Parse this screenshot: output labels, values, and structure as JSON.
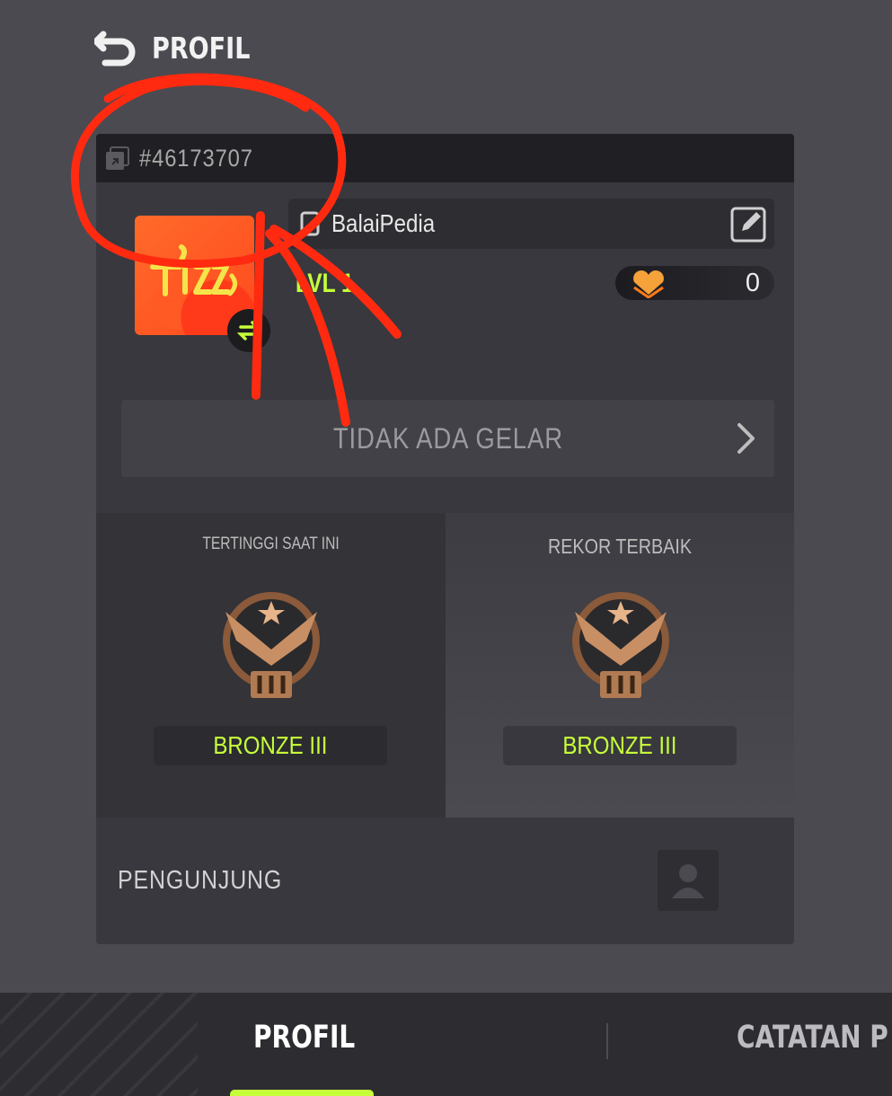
{
  "header": {
    "title": "PROFIL",
    "back_icon": "back-arrow-icon"
  },
  "profile": {
    "id_text": "#46173707",
    "nickname": "BalaiPedia",
    "level": "LVL 1",
    "likes_count": "0",
    "avatar_icon": "pizza-avatar-icon",
    "edit_icon": "edit-icon",
    "copy_icon": "copy-icon"
  },
  "title_row": {
    "text": "TIDAK ADA GELAR"
  },
  "ranks": {
    "current": {
      "heading": "TERTINGGI SAAT INI",
      "rank": "BRONZE III"
    },
    "best": {
      "heading": "REKOR TERBAIK",
      "rank": "BRONZE III"
    }
  },
  "visitors": {
    "label": "PENGUNJUNG"
  },
  "bottom_nav": {
    "tabs": [
      {
        "label": "PROFIL",
        "active": true
      },
      {
        "label": "CATATAN P",
        "active": false
      }
    ]
  },
  "colors": {
    "accent": "#c6ff3a",
    "annotation": "#ff2a10",
    "background": "#4a4a50"
  }
}
